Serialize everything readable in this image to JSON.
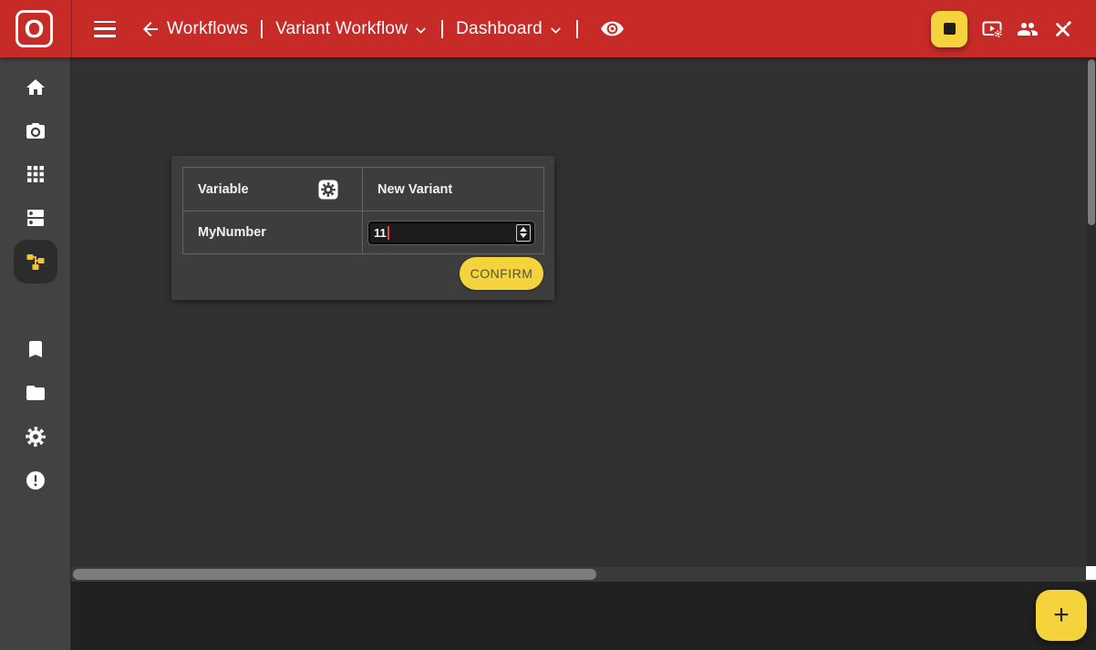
{
  "app": {
    "logo_letter": "O"
  },
  "topbar": {
    "nav": {
      "workflows_label": "Workflows",
      "workflow_selector": "Variant Workflow",
      "view_selector": "Dashboard",
      "separator": "|"
    },
    "right_icons": [
      "stop-icon",
      "video-settings-icon",
      "people-icon",
      "edit-off-icon"
    ]
  },
  "sidebar": {
    "icons": [
      "home-icon",
      "camera-icon",
      "apps-grid-icon",
      "dns-icon",
      "workflow-schema-icon",
      "bookmark-icon",
      "folder-icon",
      "settings-gear-icon",
      "error-icon"
    ],
    "active_item": "workflow-schema-icon"
  },
  "panel": {
    "headers": {
      "variable": "Variable",
      "new_variant": "New Variant"
    },
    "rows": [
      {
        "variable": "MyNumber",
        "value": "11"
      }
    ],
    "confirm_label": "CONFIRM"
  },
  "fab": {
    "label": "+"
  },
  "colors": {
    "topbar_red": "#c62b28",
    "accent_yellow": "#f5d33c",
    "caret_red": "#e8453c",
    "sidebar_gray": "#424242",
    "card_gray": "#3d3d3d",
    "bottom_black": "#212121"
  }
}
